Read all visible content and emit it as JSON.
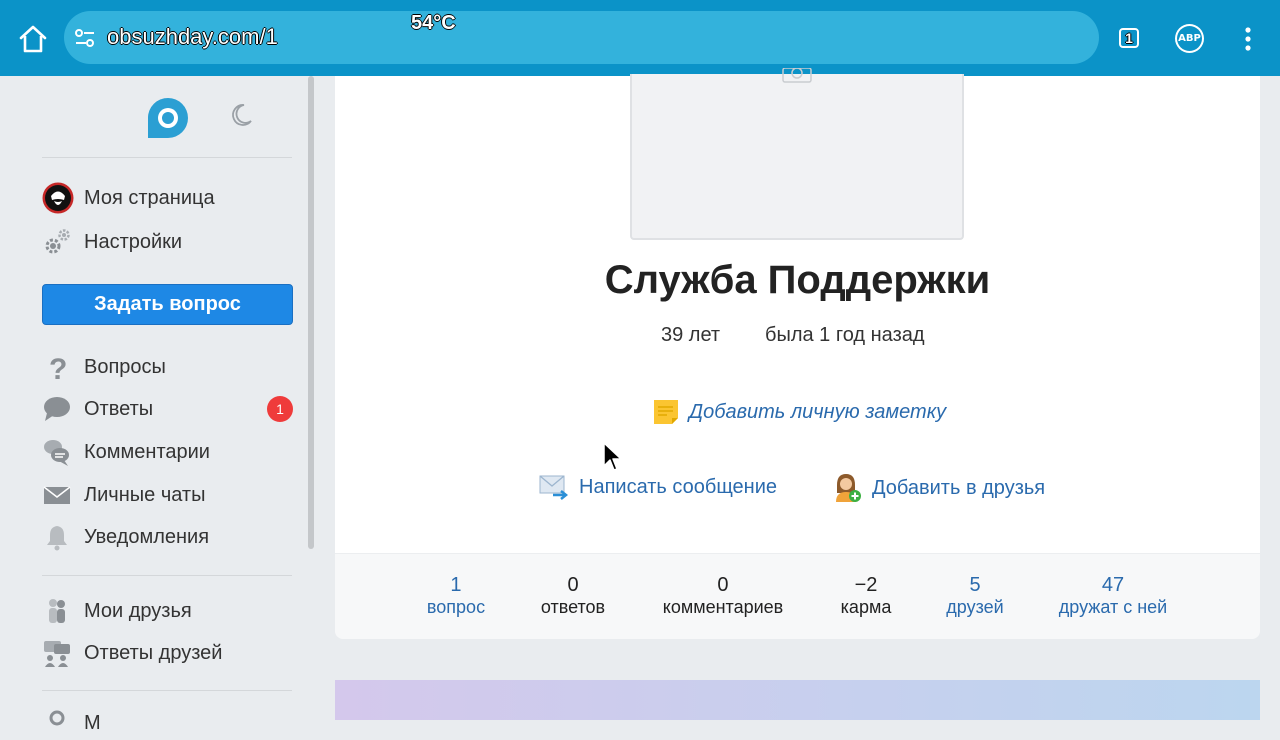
{
  "browser": {
    "url": "obsuzhday.com/1",
    "temperature": "54°C",
    "tab_count": "1",
    "abp_label": "ABP"
  },
  "sidebar": {
    "user_items": [
      {
        "label": "Моя страница",
        "icon": "avatar"
      },
      {
        "label": "Настройки",
        "icon": "gear-icon"
      }
    ],
    "ask_button": "Задать вопрос",
    "nav_items": [
      {
        "label": "Вопросы",
        "icon": "question-icon"
      },
      {
        "label": "Ответы",
        "icon": "speech-bubble-icon",
        "badge": "1"
      },
      {
        "label": "Комментарии",
        "icon": "comments-icon"
      },
      {
        "label": "Личные чаты",
        "icon": "envelope-icon"
      },
      {
        "label": "Уведомления",
        "icon": "bell-icon"
      }
    ],
    "friend_items": [
      {
        "label": "Мои друзья",
        "icon": "friends-icon"
      },
      {
        "label": "Ответы друзей",
        "icon": "friends-answers-icon"
      }
    ],
    "partial_item": {
      "label": "М",
      "icon": "user-icon"
    }
  },
  "profile": {
    "name": "Служба Поддержки",
    "age": "39 лет",
    "last_seen": "была 1 год назад",
    "add_note": "Добавить личную заметку",
    "write_message": "Написать сообщение",
    "add_friend": "Добавить в друзья",
    "stats": [
      {
        "value": "1",
        "label": "вопрос",
        "link": true
      },
      {
        "value": "0",
        "label": "ответов",
        "link": false
      },
      {
        "value": "0",
        "label": "комментариев",
        "link": false
      },
      {
        "value": "−2",
        "label": "карма",
        "link": false
      },
      {
        "value": "5",
        "label": "друзей",
        "link": true
      },
      {
        "value": "47",
        "label": "дружат с ней",
        "link": true
      }
    ]
  },
  "colors": {
    "browser_bar": "#0b93c8",
    "primary_button": "#1e88e5",
    "link": "#2a6aad",
    "badge": "#ef3b3b"
  }
}
